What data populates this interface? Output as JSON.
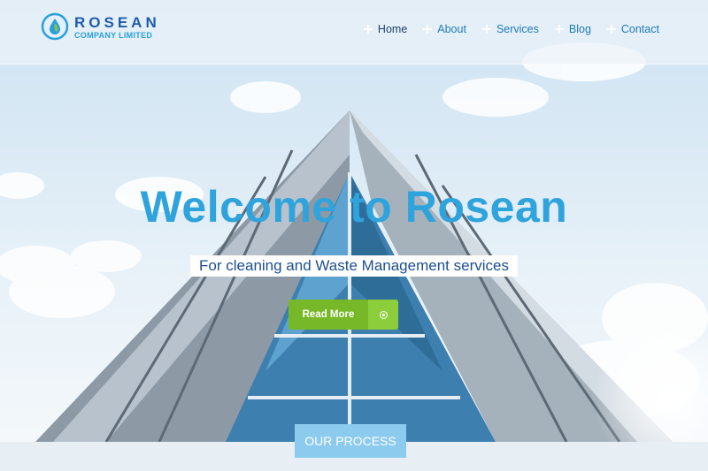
{
  "brand": {
    "name": "ROSEAN",
    "subtitle": "COMPANY LIMITED",
    "logo_icon": "water-drop-leaf-icon"
  },
  "nav": {
    "items": [
      {
        "label": "Home",
        "active": true
      },
      {
        "label": "About",
        "active": false
      },
      {
        "label": "Services",
        "active": false
      },
      {
        "label": "Blog",
        "active": false
      },
      {
        "label": "Contact",
        "active": false
      }
    ]
  },
  "hero": {
    "title": "Welcome to Rosean",
    "subtitle": "For cleaning and Waste Management services",
    "cta_label": "Read More",
    "cta_icon": "circle-dot-icon"
  },
  "process": {
    "button_label": "OUR PROCESS"
  },
  "colors": {
    "accent_blue": "#2fa3dc",
    "brand_dark": "#1f5da8",
    "cta_green": "#7cbf2a",
    "process_blue": "#8ccbee"
  }
}
